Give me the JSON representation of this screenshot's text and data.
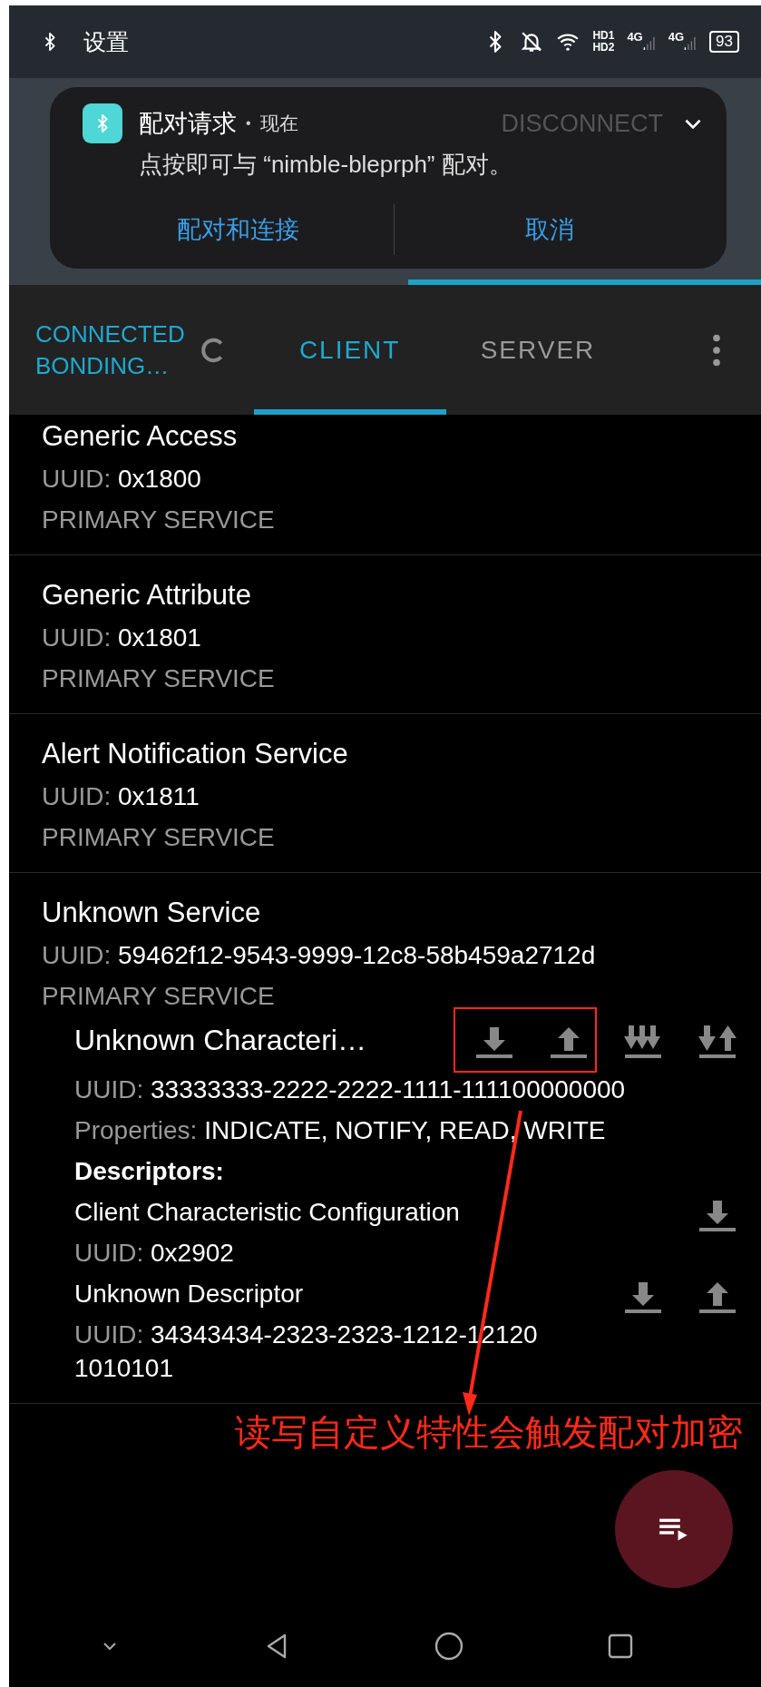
{
  "status_bar": {
    "app_label": "设置",
    "network": [
      "HD1",
      "HD2"
    ],
    "signal_labels": [
      "4G",
      "4G"
    ],
    "battery": "93"
  },
  "notification": {
    "title": "配对请求",
    "separator": "•",
    "time": "现在",
    "message": "点按即可与 “nimble-bleprph” 配对。",
    "actions": [
      "配对和连接",
      "取消"
    ],
    "background_text": "DISCONNECT"
  },
  "connection": {
    "status": "CONNECTED",
    "bond_state": "BONDING…"
  },
  "tabs": [
    {
      "label": "CLIENT",
      "selected": true
    },
    {
      "label": "SERVER",
      "selected": false
    }
  ],
  "services": [
    {
      "name": "Generic Access",
      "uuid_label": "UUID:",
      "uuid": "0x1800",
      "type": "PRIMARY SERVICE"
    },
    {
      "name": "Generic Attribute",
      "uuid_label": "UUID:",
      "uuid": "0x1801",
      "type": "PRIMARY SERVICE"
    },
    {
      "name": "Alert Notification Service",
      "uuid_label": "UUID:",
      "uuid": "0x1811",
      "type": "PRIMARY SERVICE"
    },
    {
      "name": "Unknown Service",
      "uuid_label": "UUID:",
      "uuid": "59462f12-9543-9999-12c8-58b459a2712d",
      "type": "PRIMARY SERVICE",
      "characteristics": [
        {
          "name": "Unknown Characteri…",
          "uuid_label": "UUID:",
          "uuid": "33333333-2222-2222-1111-111100000000",
          "properties_label": "Properties:",
          "properties": "INDICATE, NOTIFY, READ, WRITE",
          "action_icons": [
            {
              "kind": "read"
            },
            {
              "kind": "write"
            },
            {
              "kind": "notify"
            },
            {
              "kind": "indicate"
            }
          ],
          "descriptors_label": "Descriptors:",
          "descriptors": [
            {
              "name": "Client Characteristic Configuration",
              "uuid_label": "UUID:",
              "uuid": "0x2902",
              "action_icons": [
                {
                  "kind": "read"
                }
              ]
            },
            {
              "name": "Unknown Descriptor",
              "uuid_label": "UUID:",
              "uuid": "34343434-2323-2323-1212-12120 1010101",
              "action_icons": [
                {
                  "kind": "read"
                },
                {
                  "kind": "write"
                }
              ]
            }
          ]
        }
      ]
    }
  ],
  "annotation": {
    "text": "读写自定义特性会触发配对加密"
  }
}
